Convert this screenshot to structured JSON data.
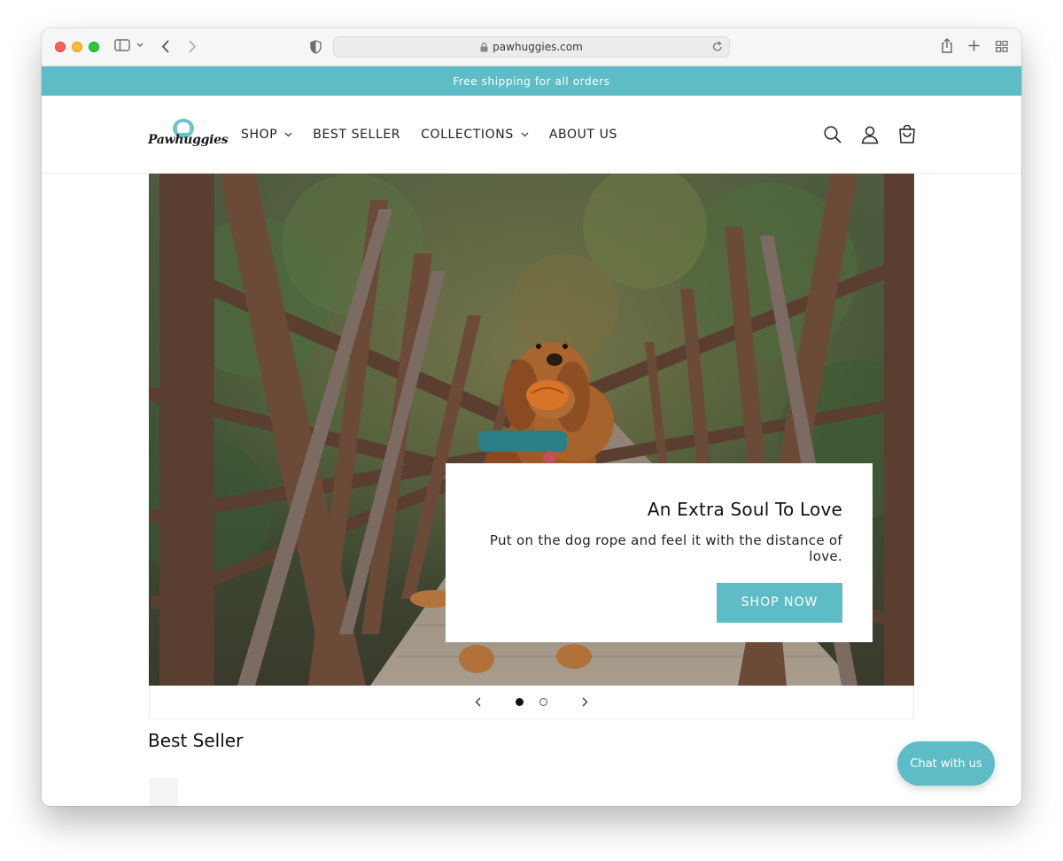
{
  "browser": {
    "url": "pawhuggies.com",
    "icons": [
      "sidebar-icon",
      "chevron-down-icon",
      "back-icon",
      "forward-icon",
      "shield-icon",
      "lock-icon",
      "reload-icon",
      "share-icon",
      "new-tab-icon",
      "tab-overview-icon"
    ]
  },
  "announcement": {
    "text": "Free shipping for all orders"
  },
  "header": {
    "logo_text": "Pawhuggies",
    "nav": [
      {
        "label": "SHOP",
        "has_dropdown": true
      },
      {
        "label": "BEST SELLER",
        "has_dropdown": false
      },
      {
        "label": "COLLECTIONS",
        "has_dropdown": true
      },
      {
        "label": "ABOUT US",
        "has_dropdown": false
      }
    ],
    "icons": [
      "search-icon",
      "account-icon",
      "cart-icon"
    ]
  },
  "hero": {
    "title": "An Extra Soul To Love",
    "subtitle": "Put on the dog rope and feel it with the distance of love.",
    "button_label": "SHOP NOW",
    "slides_total": 2,
    "active_slide": 1
  },
  "section": {
    "title": "Best Seller"
  },
  "chat": {
    "label": "Chat with us"
  },
  "colors": {
    "accent": "#5dbcc6",
    "text": "#111111"
  }
}
